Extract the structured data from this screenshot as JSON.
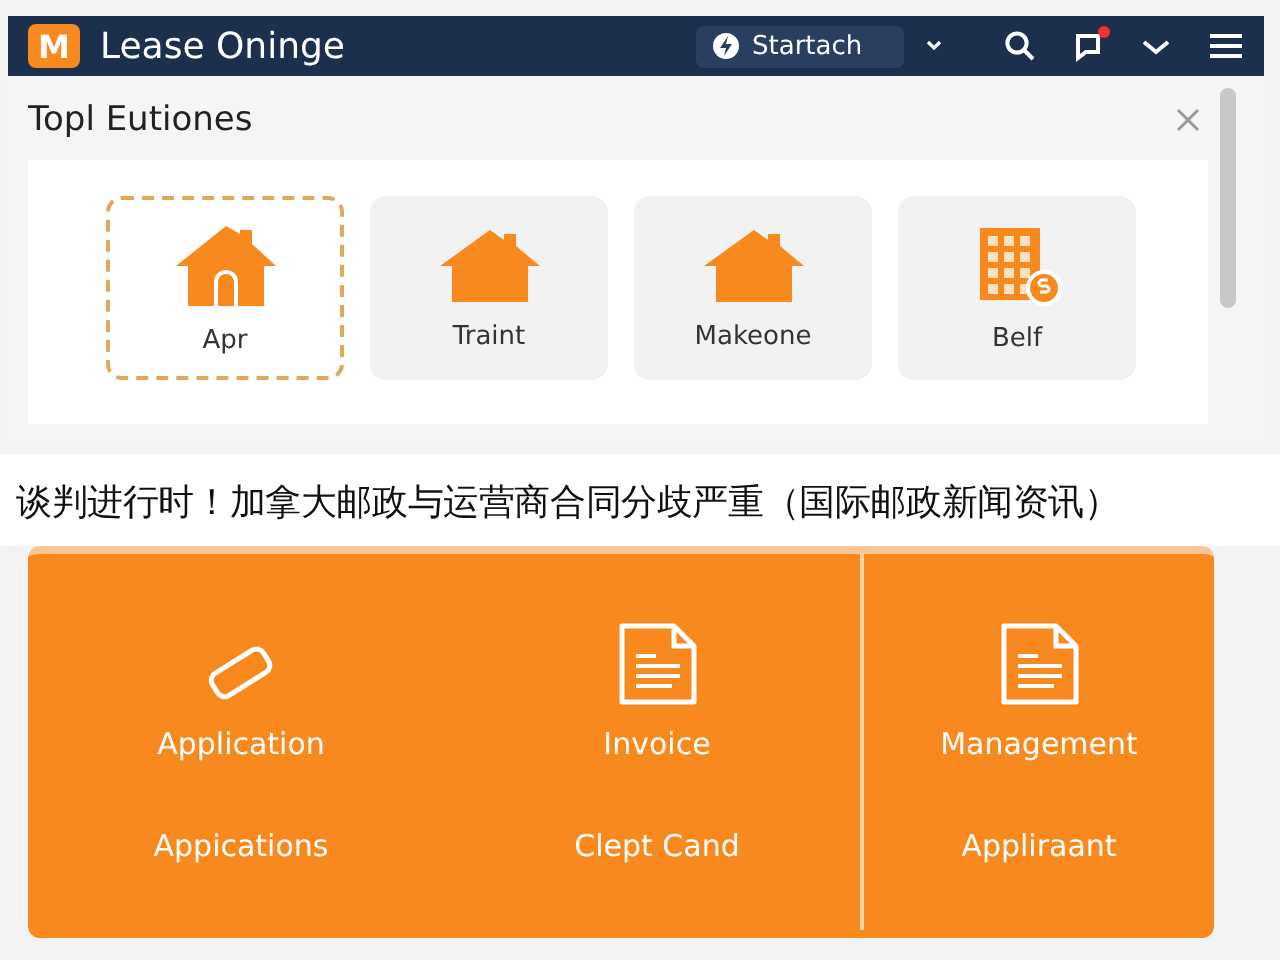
{
  "header": {
    "logo": "M",
    "title": "Lease Oninge",
    "search": {
      "value": "Startach"
    },
    "notification_badge": true
  },
  "panel": {
    "title": "Topl Eutiones",
    "tiles": [
      {
        "label": "Apr",
        "kind": "house-door",
        "selected": true
      },
      {
        "label": "Traint",
        "kind": "house",
        "selected": false
      },
      {
        "label": "Makeone",
        "kind": "house",
        "selected": false
      },
      {
        "label": "Belf",
        "kind": "building",
        "selected": false
      }
    ]
  },
  "caption": "谈判进行时！加拿大邮政与运营商合同分歧严重（国际邮政新闻资讯）",
  "actions": [
    {
      "label": "Application",
      "kind": "tag"
    },
    {
      "label": "Invoice",
      "kind": "document"
    },
    {
      "label": "Management",
      "kind": "document"
    },
    {
      "label": "Appications",
      "kind": "text"
    },
    {
      "label": "Clept Cand",
      "kind": "text"
    },
    {
      "label": "Appliraant",
      "kind": "text"
    }
  ]
}
